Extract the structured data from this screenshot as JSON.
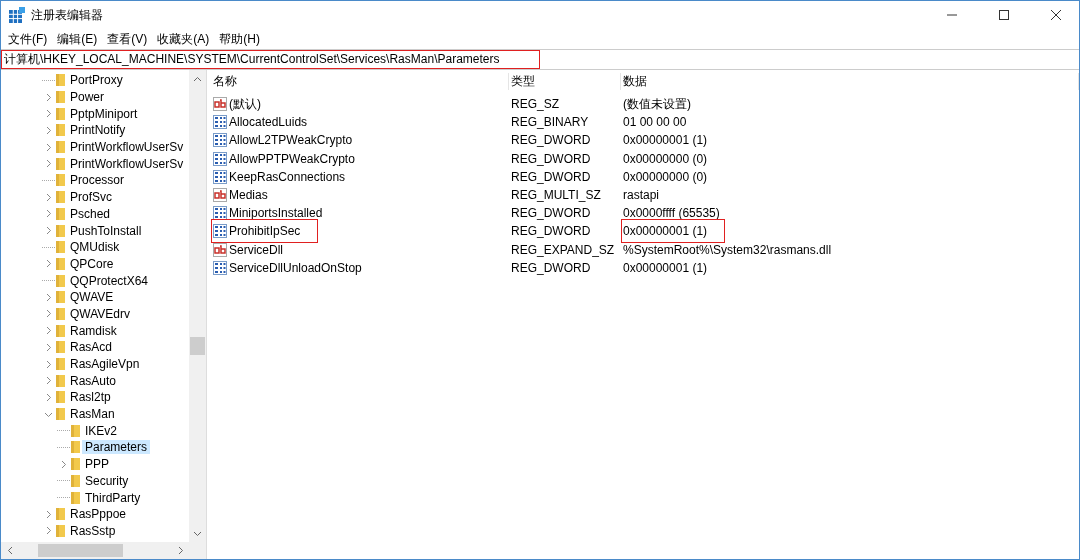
{
  "window": {
    "title": "注册表编辑器"
  },
  "menu": [
    "文件(F)",
    "编辑(E)",
    "查看(V)",
    "收藏夹(A)",
    "帮助(H)"
  ],
  "address": {
    "value": "计算机\\HKEY_LOCAL_MACHINE\\SYSTEM\\CurrentControlSet\\Services\\RasMan\\Parameters",
    "highlighted": true
  },
  "tree": [
    {
      "label": "PortProxy",
      "kind": "leaf",
      "selected": false
    },
    {
      "label": "Power",
      "kind": "branch",
      "expanded": false,
      "selected": false
    },
    {
      "label": "PptpMiniport",
      "kind": "branch",
      "expanded": false,
      "selected": false
    },
    {
      "label": "PrintNotify",
      "kind": "branch",
      "expanded": false,
      "selected": false
    },
    {
      "label": "PrintWorkflowUserSv",
      "kind": "branch",
      "expanded": false,
      "selected": false
    },
    {
      "label": "PrintWorkflowUserSv",
      "kind": "branch",
      "expanded": false,
      "selected": false
    },
    {
      "label": "Processor",
      "kind": "leaf",
      "selected": false
    },
    {
      "label": "ProfSvc",
      "kind": "branch",
      "expanded": false,
      "selected": false
    },
    {
      "label": "Psched",
      "kind": "branch",
      "expanded": false,
      "selected": false
    },
    {
      "label": "PushToInstall",
      "kind": "branch",
      "expanded": false,
      "selected": false
    },
    {
      "label": "QMUdisk",
      "kind": "leaf",
      "selected": false
    },
    {
      "label": "QPCore",
      "kind": "branch",
      "expanded": false,
      "selected": false
    },
    {
      "label": "QQProtectX64",
      "kind": "leaf",
      "selected": false
    },
    {
      "label": "QWAVE",
      "kind": "branch",
      "expanded": false,
      "selected": false
    },
    {
      "label": "QWAVEdrv",
      "kind": "branch",
      "expanded": false,
      "selected": false
    },
    {
      "label": "Ramdisk",
      "kind": "branch",
      "expanded": false,
      "selected": false
    },
    {
      "label": "RasAcd",
      "kind": "branch",
      "expanded": false,
      "selected": false
    },
    {
      "label": "RasAgileVpn",
      "kind": "branch",
      "expanded": false,
      "selected": false
    },
    {
      "label": "RasAuto",
      "kind": "branch",
      "expanded": false,
      "selected": false
    },
    {
      "label": "Rasl2tp",
      "kind": "branch",
      "expanded": false,
      "selected": false
    },
    {
      "label": "RasMan",
      "kind": "branch",
      "expanded": true,
      "selected": false,
      "children": [
        {
          "label": "IKEv2",
          "kind": "leaf",
          "selected": false
        },
        {
          "label": "Parameters",
          "kind": "leaf",
          "selected": true
        },
        {
          "label": "PPP",
          "kind": "branch",
          "expanded": false,
          "selected": false
        },
        {
          "label": "Security",
          "kind": "leaf",
          "selected": false
        },
        {
          "label": "ThirdParty",
          "kind": "leaf",
          "selected": false
        }
      ]
    },
    {
      "label": "RasPppoe",
      "kind": "branch",
      "expanded": false,
      "selected": false
    },
    {
      "label": "RasSstp",
      "kind": "branch",
      "expanded": false,
      "selected": false
    }
  ],
  "table": {
    "columns": [
      "名称",
      "类型",
      "数据"
    ],
    "rows": [
      {
        "kind": "string",
        "name": "(默认)",
        "type": "REG_SZ",
        "data": "(数值未设置)",
        "highlighted": false
      },
      {
        "kind": "binary",
        "name": "AllocatedLuids",
        "type": "REG_BINARY",
        "data": "01 00 00 00",
        "highlighted": false
      },
      {
        "kind": "binary",
        "name": "AllowL2TPWeakCrypto",
        "type": "REG_DWORD",
        "data": "0x00000001 (1)",
        "highlighted": false
      },
      {
        "kind": "binary",
        "name": "AllowPPTPWeakCrypto",
        "type": "REG_DWORD",
        "data": "0x00000000 (0)",
        "highlighted": false
      },
      {
        "kind": "binary",
        "name": "KeepRasConnections",
        "type": "REG_DWORD",
        "data": "0x00000000 (0)",
        "highlighted": false
      },
      {
        "kind": "string",
        "name": "Medias",
        "type": "REG_MULTI_SZ",
        "data": "rastapi",
        "highlighted": false
      },
      {
        "kind": "binary",
        "name": "MiniportsInstalled",
        "type": "REG_DWORD",
        "data": "0x0000ffff (65535)",
        "highlighted": false
      },
      {
        "kind": "binary",
        "name": "ProhibitIpSec",
        "type": "REG_DWORD",
        "data": "0x00000001 (1)",
        "highlighted": true
      },
      {
        "kind": "string",
        "name": "ServiceDll",
        "type": "REG_EXPAND_SZ",
        "data": "%SystemRoot%\\System32\\rasmans.dll",
        "highlighted": false
      },
      {
        "kind": "binary",
        "name": "ServiceDllUnloadOnStop",
        "type": "REG_DWORD",
        "data": "0x00000001 (1)",
        "highlighted": false
      }
    ]
  }
}
